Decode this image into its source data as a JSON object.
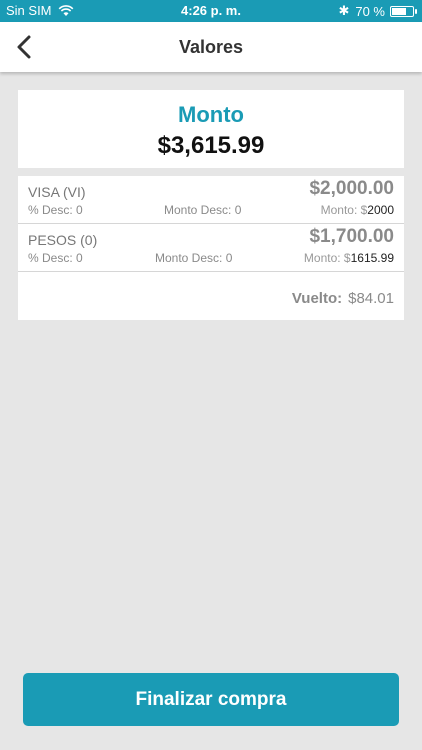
{
  "status_bar": {
    "carrier": "Sin SIM",
    "time": "4:26 p. m.",
    "battery": "70 %",
    "battery_level": 0.7
  },
  "nav": {
    "title": "Valores"
  },
  "total": {
    "label": "Monto",
    "value": "$3,615.99"
  },
  "payments": [
    {
      "method": "VISA (VI)",
      "amount": "$2,000.00",
      "desc": "% Desc: 0",
      "monto_desc": "Monto Desc: 0",
      "monto_label": "Monto: $",
      "monto_value": "2000"
    },
    {
      "method": "PESOS (0)",
      "amount": "$1,700.00",
      "desc": "% Desc: 0",
      "monto_desc": "Monto Desc: 0",
      "monto_label": "Monto: $",
      "monto_value": "1615.99"
    }
  ],
  "change": {
    "label": "Vuelto:",
    "value": "$84.01"
  },
  "actions": {
    "finish_label": "Finalizar compra"
  },
  "colors": {
    "accent": "#1a9bb5",
    "background": "#e6e6e6"
  }
}
